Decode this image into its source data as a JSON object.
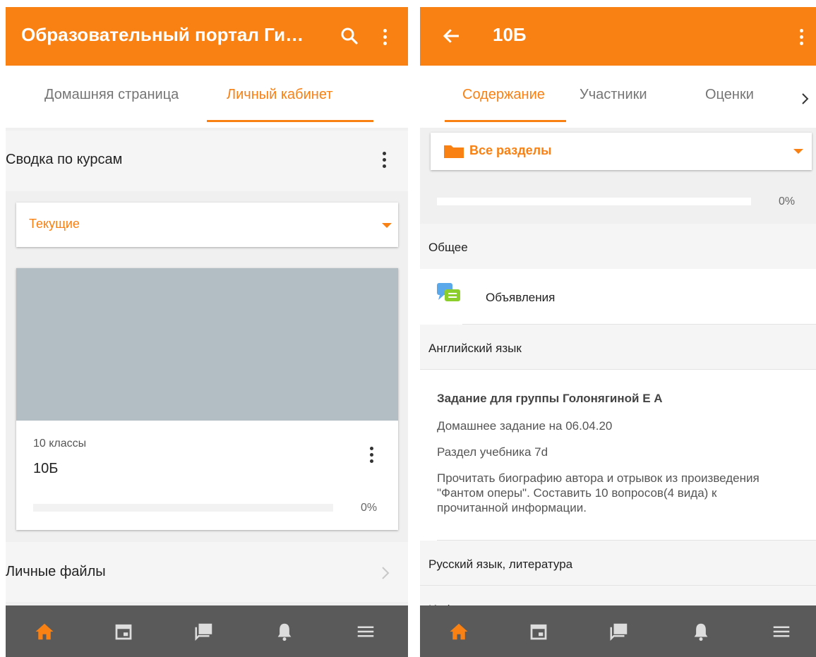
{
  "left": {
    "appbar": {
      "title": "Образовательный портал Ги…"
    },
    "tabs": [
      {
        "label": "Домашняя страница"
      },
      {
        "label": "Личный кабинет"
      }
    ],
    "overview": {
      "title": "Сводка по курсам"
    },
    "filter": {
      "selected": "Текущие"
    },
    "course": {
      "category": "10 классы",
      "name": "10Б",
      "progress_label": "0%",
      "progress": 0
    },
    "private_files": {
      "label": "Личные файлы"
    }
  },
  "right": {
    "appbar": {
      "title": "10Б"
    },
    "tabs": [
      {
        "label": "Содержание"
      },
      {
        "label": "Участники"
      },
      {
        "label": "Оценки"
      }
    ],
    "sections_select": {
      "selected": "Все разделы"
    },
    "progress": {
      "label": "0%",
      "value": 0
    },
    "sections": [
      {
        "title": "Общее"
      },
      {
        "title": "Английский язык"
      },
      {
        "title": "Русский язык, литература"
      }
    ],
    "announcements": {
      "label": "Объявления"
    },
    "assignment": {
      "title": "Задание для группы Голонягиной Е А",
      "line1": "Домашнее задание на 06.04.20",
      "line2": "Раздел учебника 7d",
      "body": "Прочитать биографию автора и отрывок из произведения \"Фантом оперы\". Составить 10 вопросов(4 вида) к прочитанной информации."
    },
    "cut_section": {
      "title": "Инф"
    }
  },
  "colors": {
    "accent": "#f98012",
    "bottom_nav": "#5a5a5a",
    "course_image": "#b2bec4"
  },
  "bottom_nav_icons": [
    "home-icon",
    "calendar-icon",
    "messages-icon",
    "notifications-icon",
    "menu-icon"
  ]
}
